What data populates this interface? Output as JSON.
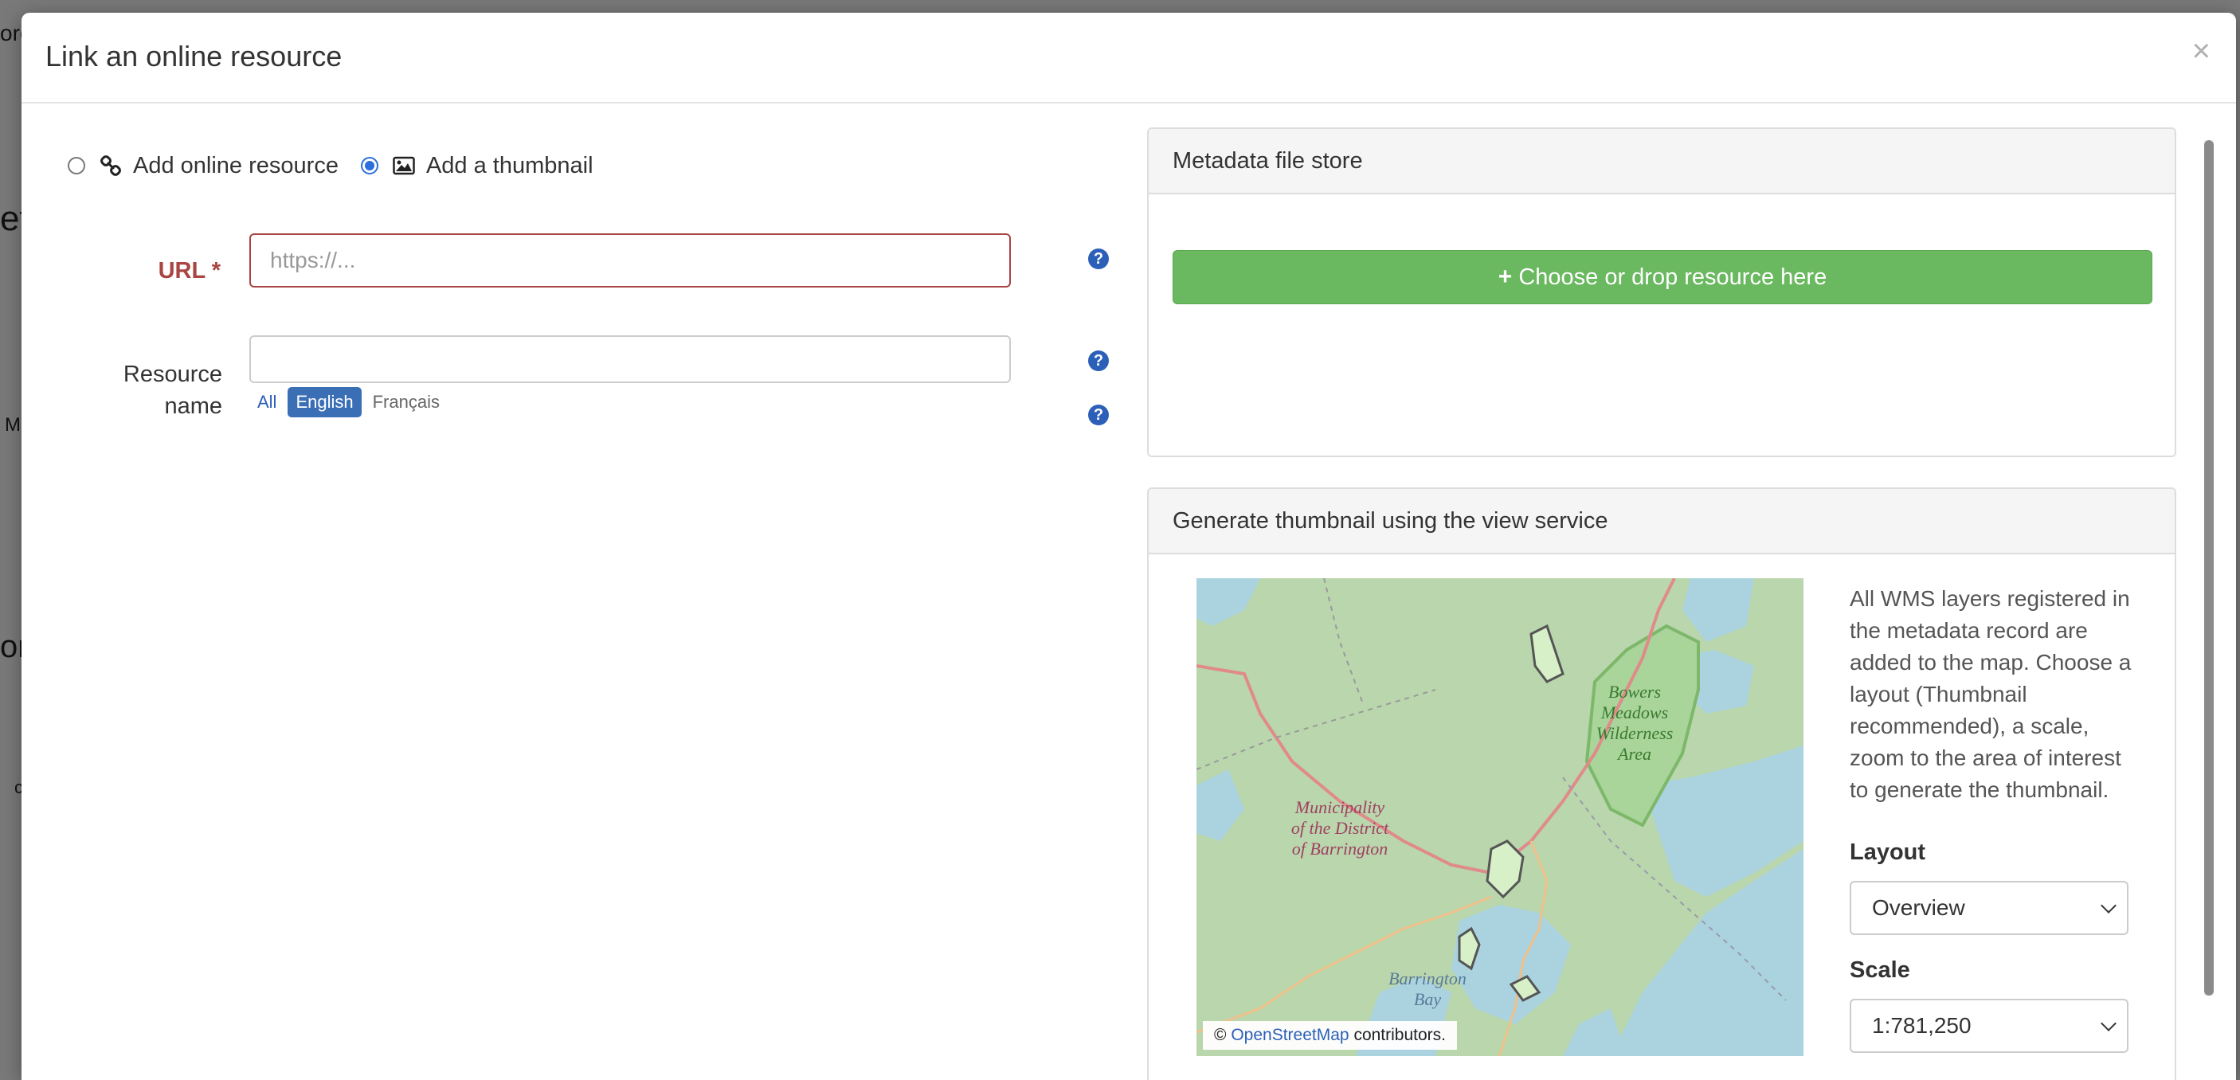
{
  "modal": {
    "title": "Link an online resource",
    "close_glyph": "×"
  },
  "resource_type": {
    "options": [
      {
        "label": "Add online resource",
        "icon": "link-icon",
        "checked": false
      },
      {
        "label": "Add a thumbnail",
        "icon": "image-icon",
        "checked": true
      }
    ]
  },
  "form": {
    "url_label": "URL *",
    "url_placeholder": "https://...",
    "resource_name_label_line1": "Resource",
    "resource_name_label_line2": "name",
    "resource_name_value": "",
    "help_glyph": "?",
    "languages": [
      "All",
      "English",
      "Français"
    ],
    "selected_language": "English"
  },
  "file_store": {
    "heading": "Metadata file store",
    "upload_label": "Choose or drop resource here",
    "upload_icon": "plus-icon",
    "upload_color": "#6ab85f"
  },
  "thumbnail": {
    "heading": "Generate thumbnail using the view service",
    "description": "All WMS layers registered in the metadata record are added to the map. Choose a layout (Thumbnail recommended), a scale, zoom to the area of interest to generate the thumbnail.",
    "layout_label": "Layout",
    "layout_value": "Overview",
    "scale_label": "Scale",
    "scale_value": "1:781,250",
    "map": {
      "labels": {
        "municipality": [
          "Municipality",
          "of the District",
          "of Barrington"
        ],
        "wilderness": [
          "Bowers",
          "Meadows",
          "Wilderness",
          "Area"
        ],
        "bay": [
          "Barrington",
          "Bay"
        ]
      },
      "attribution_prefix": "©",
      "attribution_link": "OpenStreetMap",
      "attribution_suffix": "contributors."
    }
  },
  "colors": {
    "error": "#a94442",
    "primary": "#2c5fb8",
    "success": "#6ab85f"
  }
}
